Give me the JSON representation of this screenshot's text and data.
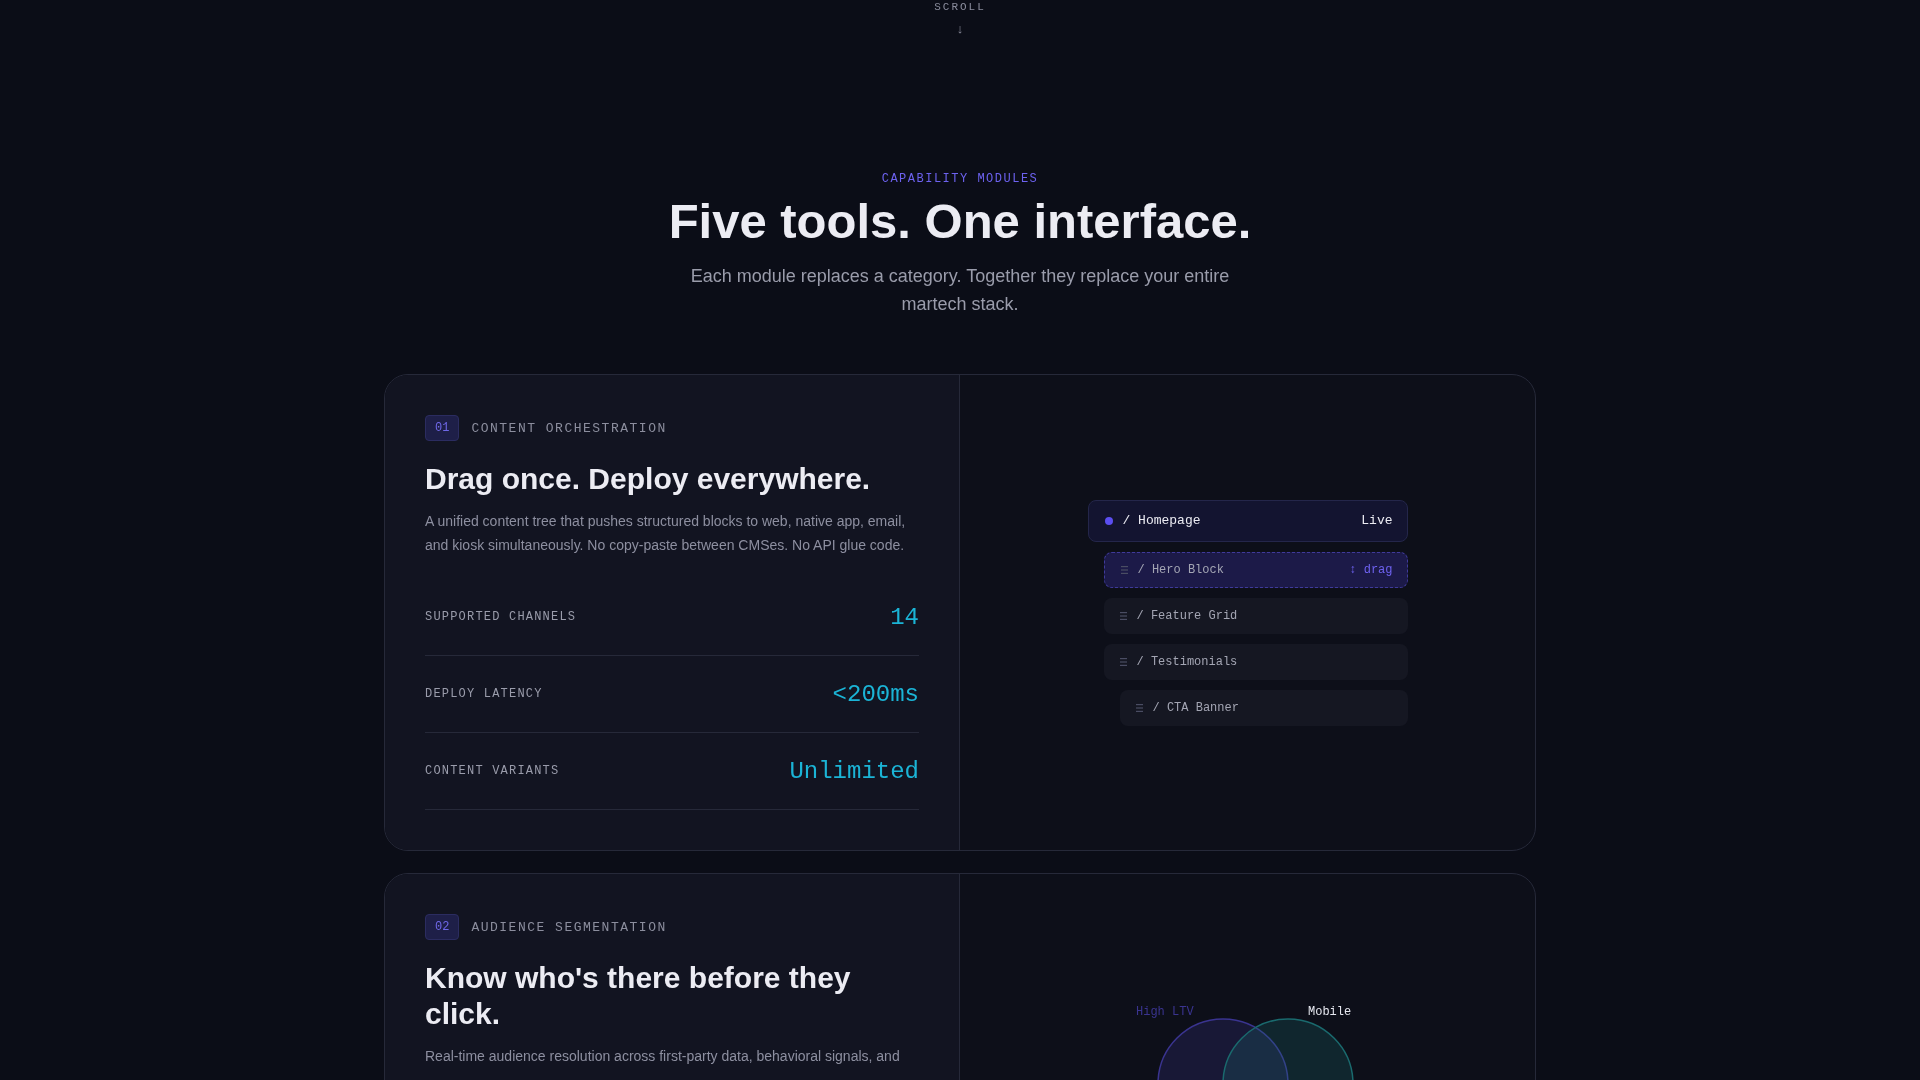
{
  "scroll_hint": {
    "label": "SCROLL",
    "arrow": "↓"
  },
  "section": {
    "eyebrow": "CAPABILITY MODULES",
    "title": "Five tools. One interface.",
    "subtitle": "Each module replaces a category. Together they replace your entire martech stack."
  },
  "modules": [
    {
      "number": "01",
      "category": "CONTENT ORCHESTRATION",
      "title": "Drag once. Deploy everywhere.",
      "description": "A unified content tree that pushes structured blocks to web, native app, email, and kiosk simultaneously. No copy-paste between CMSes. No API glue code.",
      "stats": [
        {
          "label": "SUPPORTED CHANNELS",
          "value": "14"
        },
        {
          "label": "DEPLOY LATENCY",
          "value": "<200ms"
        },
        {
          "label": "CONTENT VARIANTS",
          "value": "Unlimited"
        }
      ],
      "visual": {
        "kind": "tree",
        "nodes": [
          {
            "label": "/ Homepage",
            "status": "Live",
            "dragging": false,
            "children": [
              {
                "label": "/ Hero Block",
                "dragging": true,
                "badge": "↕ drag"
              },
              {
                "label": "/ Feature Grid",
                "dragging": false
              },
              {
                "label": "/ Testimonials",
                "dragging": false,
                "children": [
                  {
                    "label": "/ CTA Banner",
                    "dragging": false
                  }
                ]
              }
            ]
          }
        ]
      }
    },
    {
      "number": "02",
      "category": "AUDIENCE SEGMENTATION",
      "title": "Know who's there before they click.",
      "description": "Real-time audience resolution across first-party data, behavioral signals, and",
      "visual": {
        "kind": "venn",
        "sets": [
          {
            "label": "High LTV",
            "color": "#3a3490"
          },
          {
            "label": "Mobile",
            "color": "#1a6a6e"
          }
        ]
      }
    }
  ]
}
